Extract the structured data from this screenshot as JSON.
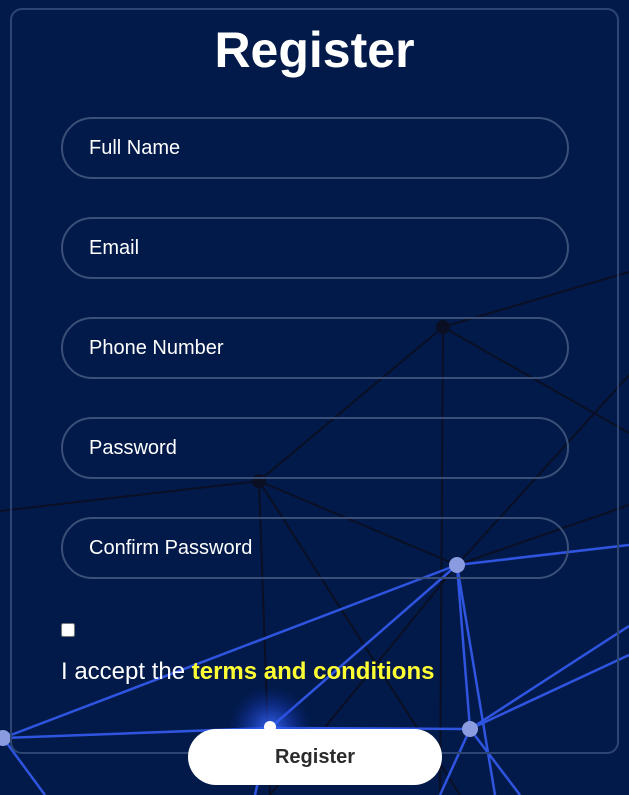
{
  "form": {
    "title": "Register",
    "fields": [
      {
        "name": "full-name-input",
        "placeholder": "Full Name",
        "value": ""
      },
      {
        "name": "email-input",
        "placeholder": "Email",
        "value": ""
      },
      {
        "name": "phone-number-input",
        "placeholder": "Phone Number",
        "value": ""
      },
      {
        "name": "password-input",
        "placeholder": "Password",
        "value": ""
      },
      {
        "name": "confirm-password-input",
        "placeholder": "Confirm Password",
        "value": ""
      }
    ],
    "terms_checked": false,
    "terms_prefix": "I accept the ",
    "terms_link": "terms and conditions",
    "submit_label": "Register"
  },
  "colors": {
    "background": "#021a4a",
    "link": "#ffff33",
    "network_dark": "#0a0f24",
    "network_bright": "#2f55e0",
    "node_bright": "#8a9be0"
  }
}
